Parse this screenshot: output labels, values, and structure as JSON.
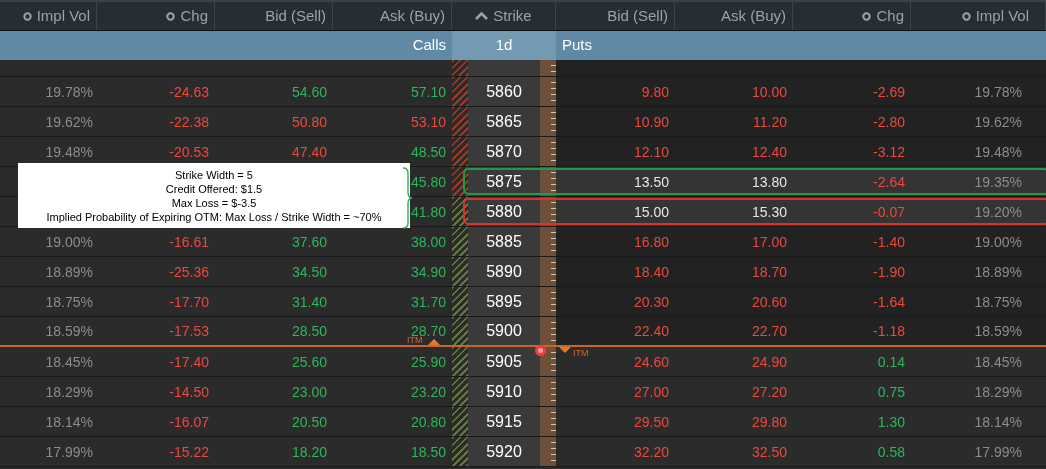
{
  "header": {
    "columns": [
      "Impl Vol",
      "Chg",
      "Bid (Sell)",
      "Ask (Buy)",
      "Strike",
      "Bid (Sell)",
      "Ask (Buy)",
      "Chg",
      "Impl Vol"
    ]
  },
  "subheader": {
    "calls": "Calls",
    "expiry": "1d",
    "puts": "Puts"
  },
  "rows": [
    {
      "strike": "5860",
      "hatch": {
        "color": "#9a3b2a"
      },
      "calls": {
        "impl_vol": {
          "text": "19.78%",
          "kind": "plain"
        },
        "chg": {
          "text": "-24.63",
          "kind": "down"
        },
        "bid": {
          "text": "54.60",
          "kind": "up"
        },
        "ask": {
          "text": "57.10",
          "kind": "up"
        }
      },
      "puts": {
        "bid": {
          "text": "9.80",
          "kind": "down"
        },
        "ask": {
          "text": "10.00",
          "kind": "down"
        },
        "chg": {
          "text": "-2.69",
          "kind": "down"
        },
        "impl_vol": {
          "text": "19.78%",
          "kind": "plain"
        }
      }
    },
    {
      "strike": "5865",
      "hatch": {
        "color": "#9a3b2a"
      },
      "calls": {
        "impl_vol": {
          "text": "19.62%",
          "kind": "plain"
        },
        "chg": {
          "text": "-22.38",
          "kind": "down"
        },
        "bid": {
          "text": "50.80",
          "kind": "down"
        },
        "ask": {
          "text": "53.10",
          "kind": "down"
        }
      },
      "puts": {
        "bid": {
          "text": "10.90",
          "kind": "down"
        },
        "ask": {
          "text": "11.20",
          "kind": "down"
        },
        "chg": {
          "text": "-2.80",
          "kind": "down"
        },
        "impl_vol": {
          "text": "19.62%",
          "kind": "plain"
        }
      }
    },
    {
      "strike": "5870",
      "hatch": {
        "color": "#9a3b2a"
      },
      "calls": {
        "impl_vol": {
          "text": "19.48%",
          "kind": "plain"
        },
        "chg": {
          "text": "-20.53",
          "kind": "down"
        },
        "bid": {
          "text": "47.40",
          "kind": "down"
        },
        "ask": {
          "text": "48.50",
          "kind": "up"
        }
      },
      "puts": {
        "bid": {
          "text": "12.10",
          "kind": "down"
        },
        "ask": {
          "text": "12.40",
          "kind": "down"
        },
        "chg": {
          "text": "-3.12",
          "kind": "down"
        },
        "impl_vol": {
          "text": "19.48%",
          "kind": "plain"
        }
      }
    },
    {
      "strike": "5875",
      "hatch": {
        "color": "#9a3b2a"
      },
      "leg": {
        "color": "#1f9a45"
      },
      "calls": {
        "ask": {
          "text": "45.80",
          "kind": "up"
        }
      },
      "puts": {
        "bid": {
          "text": "13.50",
          "kind": "flat"
        },
        "ask": {
          "text": "13.80",
          "kind": "flat"
        },
        "chg": {
          "text": "-2.64",
          "kind": "down"
        },
        "impl_vol": {
          "text": "19.35%",
          "kind": "plain"
        }
      }
    },
    {
      "strike": "5880",
      "hatch": {
        "color": "#5d7a45"
      },
      "leg": {
        "color": "#d8322a"
      },
      "calls": {
        "ask": {
          "text": "41.80",
          "kind": "up"
        }
      },
      "puts": {
        "bid": {
          "text": "15.00",
          "kind": "flat"
        },
        "ask": {
          "text": "15.30",
          "kind": "flat"
        },
        "chg": {
          "text": "-0.07",
          "kind": "down"
        },
        "impl_vol": {
          "text": "19.20%",
          "kind": "plain"
        }
      }
    },
    {
      "strike": "5885",
      "hatch": {
        "color": "#5d7a45"
      },
      "calls": {
        "impl_vol": {
          "text": "19.00%",
          "kind": "plain"
        },
        "chg": {
          "text": "-16.61",
          "kind": "down"
        },
        "bid": {
          "text": "37.60",
          "kind": "up"
        },
        "ask": {
          "text": "38.00",
          "kind": "up"
        }
      },
      "puts": {
        "bid": {
          "text": "16.80",
          "kind": "down"
        },
        "ask": {
          "text": "17.00",
          "kind": "down"
        },
        "chg": {
          "text": "-1.40",
          "kind": "down"
        },
        "impl_vol": {
          "text": "19.00%",
          "kind": "plain"
        }
      }
    },
    {
      "strike": "5890",
      "hatch": {
        "color": "#5d7a45"
      },
      "calls": {
        "impl_vol": {
          "text": "18.89%",
          "kind": "plain"
        },
        "chg": {
          "text": "-25.36",
          "kind": "down"
        },
        "bid": {
          "text": "34.50",
          "kind": "up"
        },
        "ask": {
          "text": "34.90",
          "kind": "up"
        }
      },
      "puts": {
        "bid": {
          "text": "18.40",
          "kind": "down"
        },
        "ask": {
          "text": "18.70",
          "kind": "down"
        },
        "chg": {
          "text": "-1.90",
          "kind": "down"
        },
        "impl_vol": {
          "text": "18.89%",
          "kind": "plain"
        }
      }
    },
    {
      "strike": "5895",
      "hatch": {
        "color": "#5d7a45"
      },
      "calls": {
        "impl_vol": {
          "text": "18.75%",
          "kind": "plain"
        },
        "chg": {
          "text": "-17.70",
          "kind": "down"
        },
        "bid": {
          "text": "31.40",
          "kind": "up"
        },
        "ask": {
          "text": "31.70",
          "kind": "up"
        }
      },
      "puts": {
        "bid": {
          "text": "20.30",
          "kind": "down"
        },
        "ask": {
          "text": "20.60",
          "kind": "down"
        },
        "chg": {
          "text": "-1.64",
          "kind": "down"
        },
        "impl_vol": {
          "text": "18.75%",
          "kind": "plain"
        }
      }
    },
    {
      "strike": "5900",
      "hatch": {
        "color": "#5d7a45"
      },
      "itm_break": true,
      "calls": {
        "impl_vol": {
          "text": "18.59%",
          "kind": "plain"
        },
        "chg": {
          "text": "-17.53",
          "kind": "down"
        },
        "bid": {
          "text": "28.50",
          "kind": "up"
        },
        "ask": {
          "text": "28.70",
          "kind": "up"
        }
      },
      "puts": {
        "bid": {
          "text": "22.40",
          "kind": "down"
        },
        "ask": {
          "text": "22.70",
          "kind": "down"
        },
        "chg": {
          "text": "-1.18",
          "kind": "down"
        },
        "impl_vol": {
          "text": "18.59%",
          "kind": "plain"
        }
      }
    },
    {
      "strike": "5905",
      "hatch": {
        "color": "#5d7a45"
      },
      "calls": {
        "impl_vol": {
          "text": "18.45%",
          "kind": "plain"
        },
        "chg": {
          "text": "-17.40",
          "kind": "down"
        },
        "bid": {
          "text": "25.60",
          "kind": "up"
        },
        "ask": {
          "text": "25.90",
          "kind": "up"
        }
      },
      "puts": {
        "bid": {
          "text": "24.60",
          "kind": "down"
        },
        "ask": {
          "text": "24.90",
          "kind": "down"
        },
        "chg": {
          "text": "0.14",
          "kind": "up"
        },
        "impl_vol": {
          "text": "18.45%",
          "kind": "plain"
        }
      }
    },
    {
      "strike": "5910",
      "hatch": {
        "color": "#5d7a45"
      },
      "calls": {
        "impl_vol": {
          "text": "18.29%",
          "kind": "plain"
        },
        "chg": {
          "text": "-14.50",
          "kind": "down"
        },
        "bid": {
          "text": "23.00",
          "kind": "up"
        },
        "ask": {
          "text": "23.20",
          "kind": "up"
        }
      },
      "puts": {
        "bid": {
          "text": "27.00",
          "kind": "down"
        },
        "ask": {
          "text": "27.20",
          "kind": "down"
        },
        "chg": {
          "text": "0.75",
          "kind": "up"
        },
        "impl_vol": {
          "text": "18.29%",
          "kind": "plain"
        }
      }
    },
    {
      "strike": "5915",
      "hatch": {
        "color": "#5d7a45"
      },
      "calls": {
        "impl_vol": {
          "text": "18.14%",
          "kind": "plain"
        },
        "chg": {
          "text": "-16.07",
          "kind": "down"
        },
        "bid": {
          "text": "20.50",
          "kind": "up"
        },
        "ask": {
          "text": "20.80",
          "kind": "up"
        }
      },
      "puts": {
        "bid": {
          "text": "29.50",
          "kind": "down"
        },
        "ask": {
          "text": "29.80",
          "kind": "down"
        },
        "chg": {
          "text": "1.30",
          "kind": "up"
        },
        "impl_vol": {
          "text": "18.14%",
          "kind": "plain"
        }
      }
    },
    {
      "strike": "5920",
      "hatch": {
        "color": "#5d7a45"
      },
      "calls": {
        "impl_vol": {
          "text": "17.99%",
          "kind": "plain"
        },
        "chg": {
          "text": "-15.22",
          "kind": "down"
        },
        "bid": {
          "text": "18.20",
          "kind": "up"
        },
        "ask": {
          "text": "18.50",
          "kind": "up"
        }
      },
      "puts": {
        "bid": {
          "text": "32.20",
          "kind": "down"
        },
        "ask": {
          "text": "32.50",
          "kind": "down"
        },
        "chg": {
          "text": "0.58",
          "kind": "up"
        },
        "impl_vol": {
          "text": "17.99%",
          "kind": "plain"
        }
      }
    }
  ],
  "itm_labels": {
    "calls": "ITM",
    "puts": "ITM"
  },
  "note": {
    "lines": [
      "Strike Width = 5",
      "Credit Offered: $1.5",
      "Max Loss = $-3.5",
      "Implied Probability of Expiring OTM: Max Loss / Strike Width = ~70%"
    ]
  }
}
